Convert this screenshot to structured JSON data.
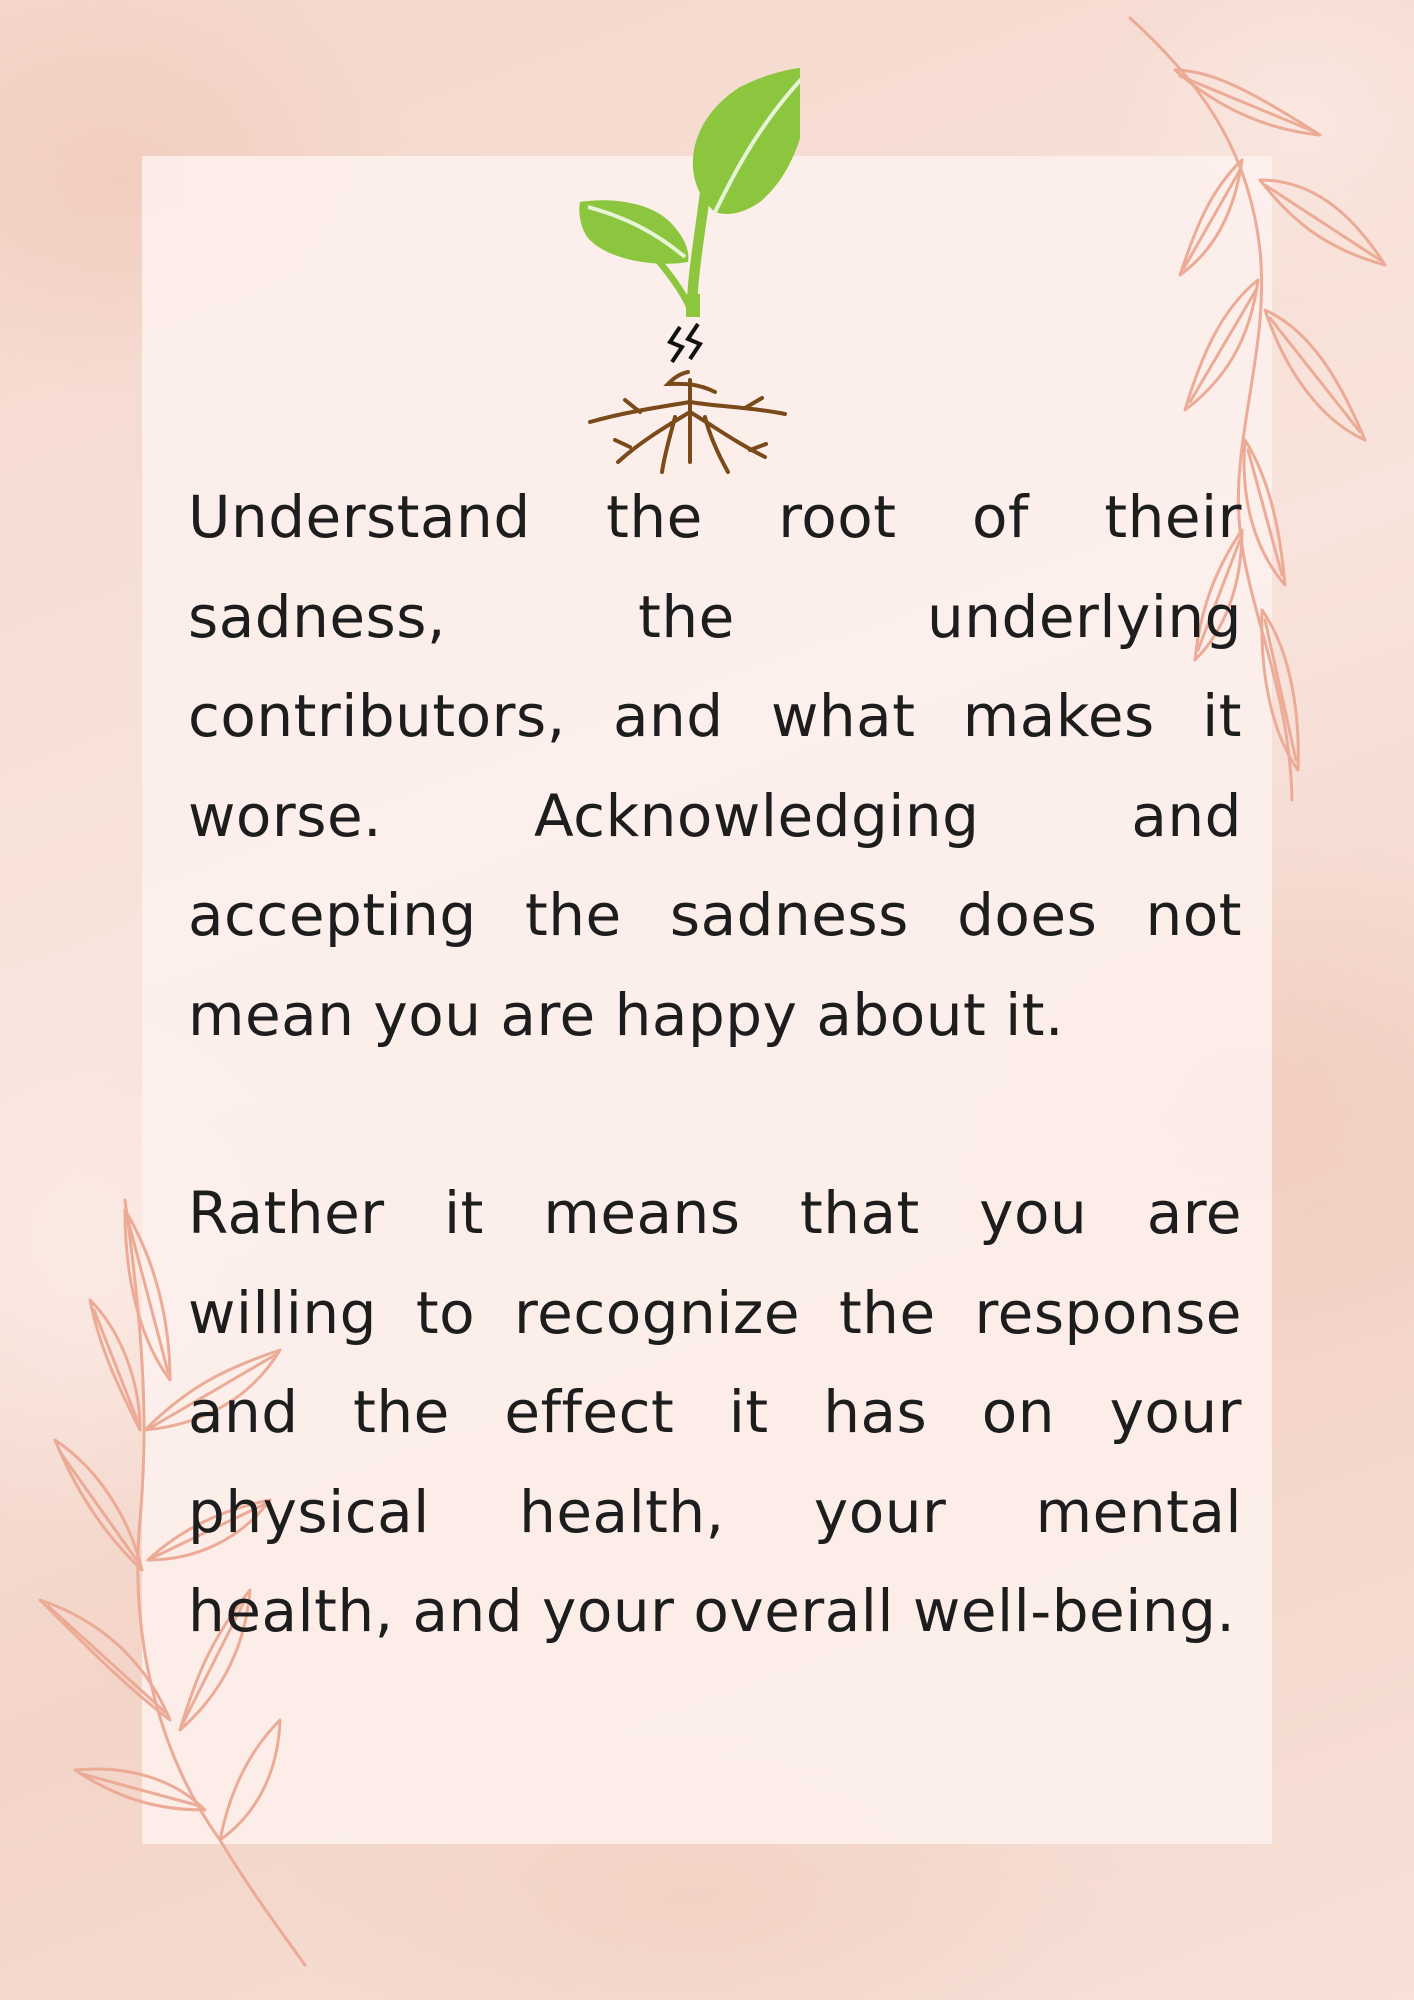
{
  "colors": {
    "background": "#f6dcd2",
    "card": "#fdf0ed",
    "vine": "#ecab96",
    "leaf_green": "#8cc63f",
    "root_brown": "#7b4a1a",
    "text": "#1d1d1d"
  },
  "icons": {
    "illustration": "sprout-with-broken-root-icon",
    "decoration_top_right": "leaf-vine-icon",
    "decoration_bottom_left": "leaf-vine-icon"
  },
  "content": {
    "paragraph_1": "Understand the root of their sadness, the underlying contributors, and what makes it worse. Acknowledging and accepting the sadness does not mean you are happy about it.",
    "paragraph_2": "Rather it means that you are willing to recognize the response and the effect it has on your physical health, your mental health, and your overall well-being."
  }
}
